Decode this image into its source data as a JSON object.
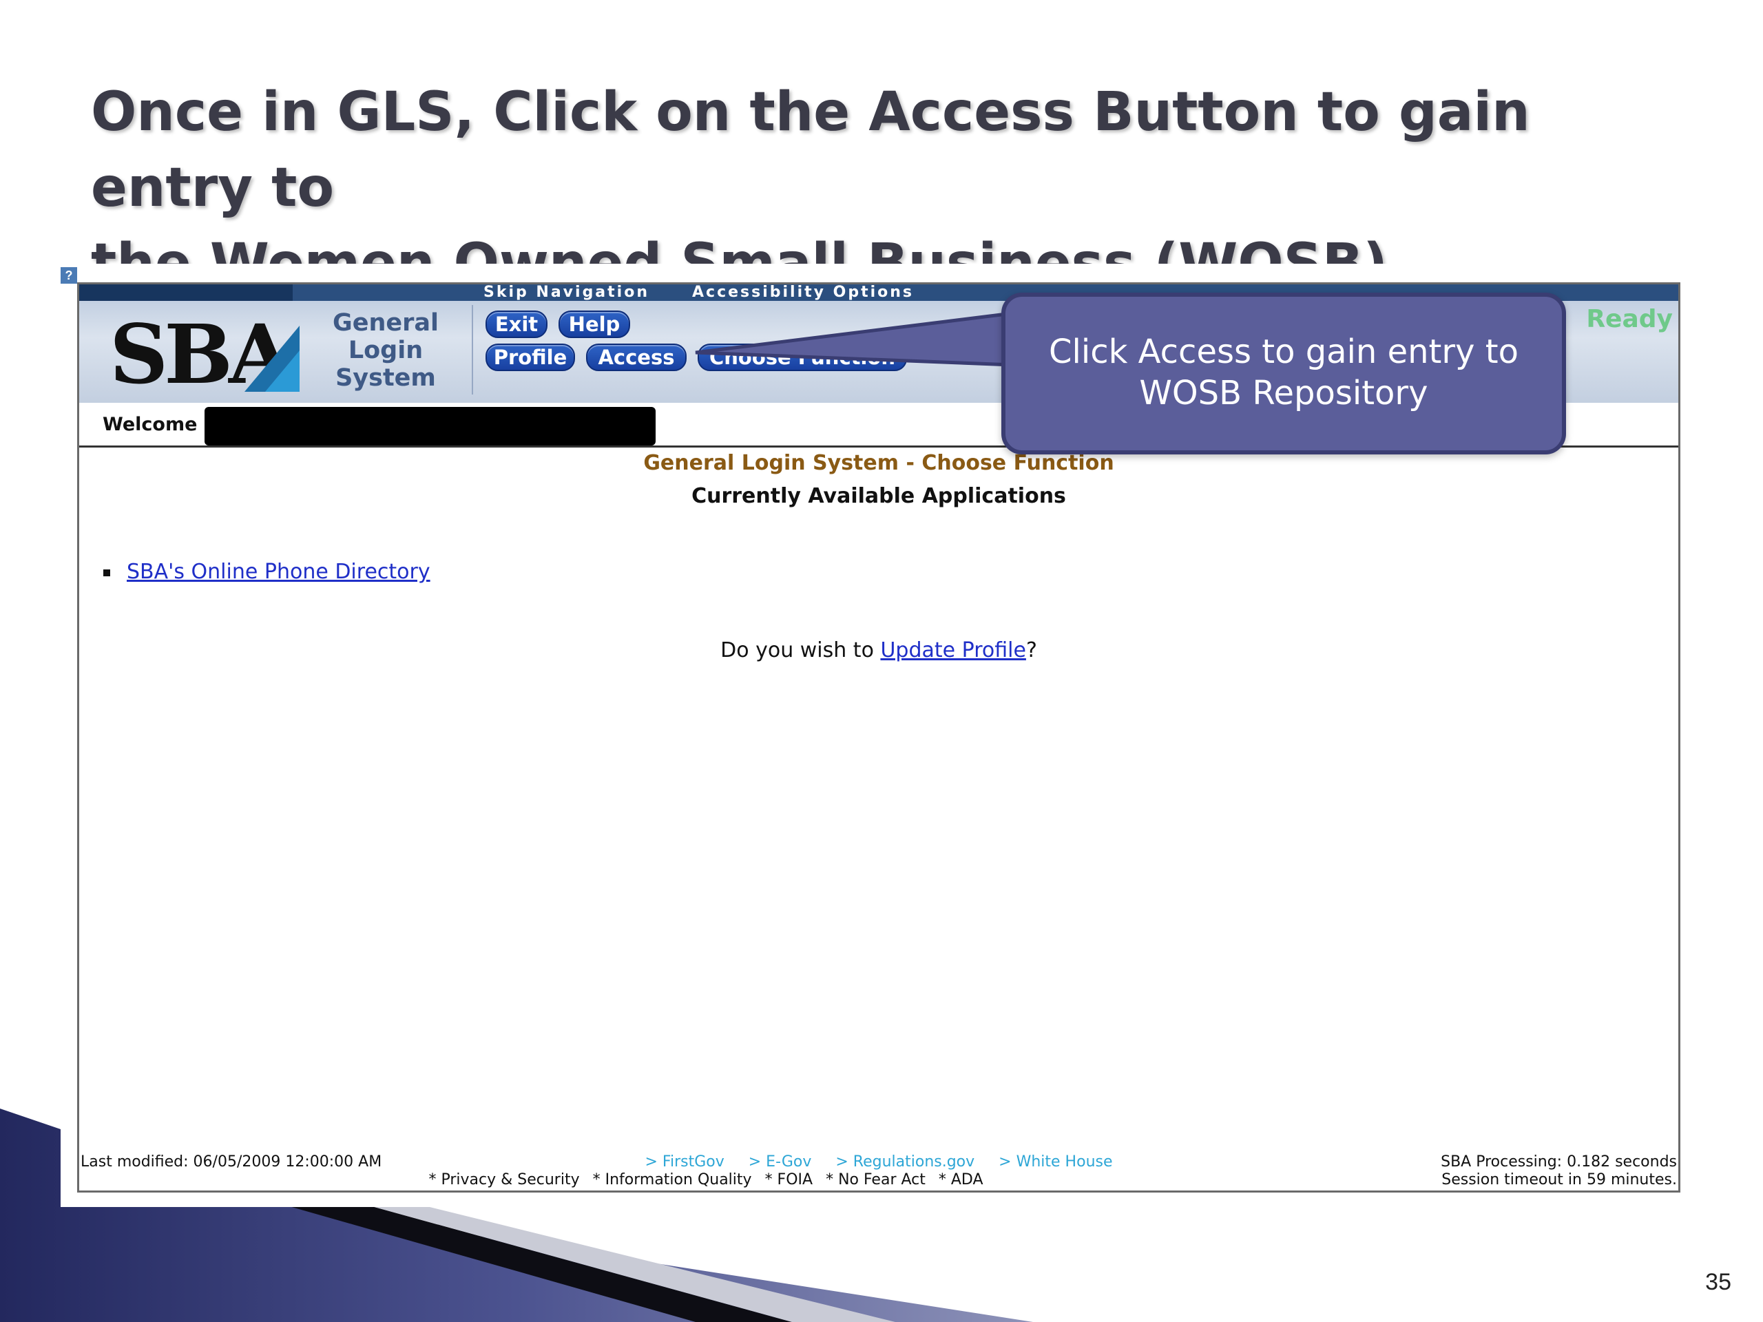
{
  "slide": {
    "title_line1": "Once in GLS, Click on the Access Button to gain entry to",
    "title_line2": "the Women Owned Small Business (WOSB) Repository",
    "page_number": "35"
  },
  "browser": {
    "help_icon": "?"
  },
  "header": {
    "skip_navigation": "Skip Navigation",
    "accessibility_options": "Accessibility Options",
    "logo_text": "SBA",
    "system_name_line1": "General",
    "system_name_line2": "Login",
    "system_name_line3": "System",
    "buttons": {
      "exit": "Exit",
      "help": "Help",
      "profile": "Profile",
      "access": "Access",
      "choose_function": "Choose Function"
    },
    "status": "Ready"
  },
  "welcome": {
    "label": "Welcome"
  },
  "main": {
    "heading": "General Login System - Choose Function",
    "subheading": "Currently Available Applications",
    "applications": [
      "SBA's Online Phone Directory"
    ],
    "update_prefix": "Do you wish to ",
    "update_link": "Update Profile",
    "update_suffix": "?"
  },
  "footer": {
    "last_modified": "Last modified: 06/05/2009 12:00:00 AM",
    "links": [
      "> FirstGov",
      "> E-Gov",
      "> Regulations.gov",
      "> White House"
    ],
    "policies": [
      "* Privacy & Security",
      "* Information Quality",
      "* FOIA",
      "* No Fear Act",
      "* ADA"
    ],
    "processing": "SBA Processing:  0.182 seconds",
    "session_timeout": "Session timeout in 59 minutes."
  },
  "callout": {
    "line1": "Click Access to gain entry to",
    "line2": "WOSB Repository"
  },
  "colors": {
    "callout_fill": "#5b5e9a",
    "button_blue": "#1f4fb4",
    "heading_brown": "#8a5a14",
    "link_blue": "#1f2fc8",
    "ready_green": "#6fc98a"
  }
}
